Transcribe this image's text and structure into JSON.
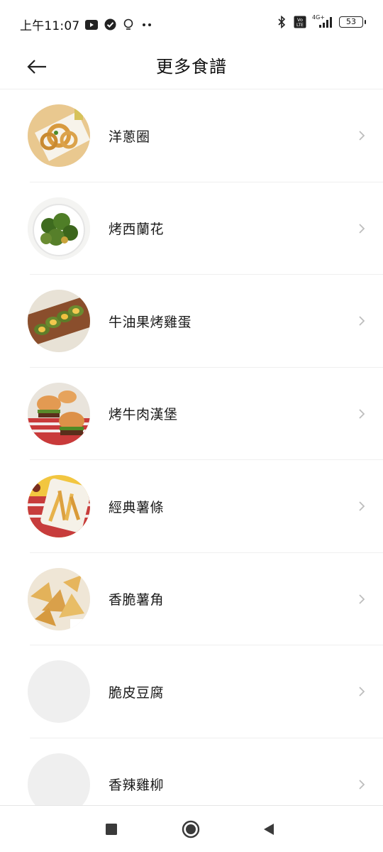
{
  "status_bar": {
    "time": "上午11:07",
    "left_icons": [
      "youtube-icon",
      "check-badge-icon",
      "bulb-icon",
      "more-dots-icon"
    ],
    "network_label": "4G+",
    "volte_label": "Vo LTE",
    "battery_level": "53"
  },
  "header": {
    "title": "更多食譜",
    "back_icon": "arrow-left-icon"
  },
  "recipes": [
    {
      "name": "洋蔥圈",
      "thumb": "onion-rings"
    },
    {
      "name": "烤西蘭花",
      "thumb": "broccoli"
    },
    {
      "name": "牛油果烤雞蛋",
      "thumb": "avocado-egg"
    },
    {
      "name": "烤牛肉漢堡",
      "thumb": "burger"
    },
    {
      "name": "經典薯條",
      "thumb": "fries"
    },
    {
      "name": "香脆薯角",
      "thumb": "potato-wedges"
    },
    {
      "name": "脆皮豆腐",
      "thumb": "placeholder"
    },
    {
      "name": "香辣雞柳",
      "thumb": "placeholder"
    }
  ],
  "nav_bar": {
    "buttons": [
      "square-icon",
      "home-circle-icon",
      "back-triangle-icon"
    ]
  },
  "colors": {
    "placeholder_thumb": "#efefef",
    "divider": "#efefef",
    "chevron": "#bdbdbd"
  }
}
